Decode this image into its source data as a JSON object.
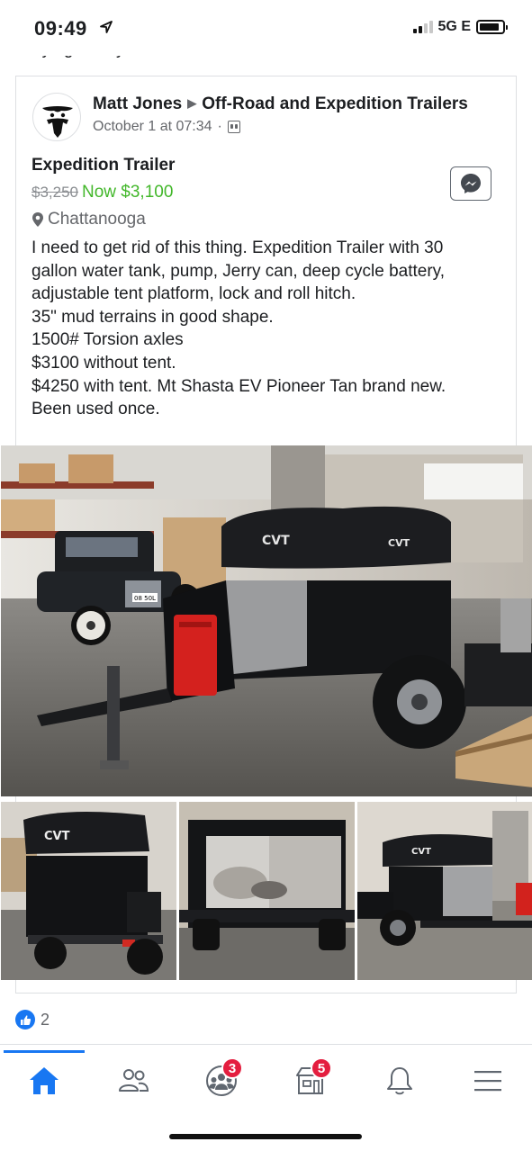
{
  "status_bar": {
    "time": "09:49",
    "network": "5G E",
    "signal_bars_on": 2,
    "signal_bars_total": 4,
    "icons": [
      "location-arrow-icon",
      "signal-icon",
      "battery-icon"
    ]
  },
  "previous_post_tail": "trying to buy a house so I need to sell it.",
  "post": {
    "author": "Matt Jones",
    "group": "Off-Road and Expedition Trailers",
    "timestamp": "October 1 at 07:34",
    "audience_icon": "group-audience-icon",
    "listing": {
      "title": "Expedition Trailer",
      "old_price": "$3,250",
      "new_price": "Now $3,100",
      "location": "Chattanooga",
      "price_color": "#42b72a"
    },
    "description": [
      "I need to get rid of this thing. Expedition Trailer with 30",
      "gallon water tank, pump, Jerry can, deep cycle battery,",
      "adjustable tent platform, lock and roll hitch.",
      "35\" mud terrains in good shape.",
      "1500# Torsion axles",
      "$3100 without tent.",
      "$4250 with tent. Mt Shasta EV  Pioneer Tan brand new.",
      "Been used once."
    ],
    "photos": {
      "main": "expedition-trailer-photo",
      "thumbnails": [
        "trailer-rear-photo",
        "trailer-open-storage-photo",
        "trailer-side-photo"
      ],
      "tent_brand_text": "CVT",
      "plate_text": "08 50L"
    },
    "reactions": {
      "like_count": "2",
      "icon": "like-icon"
    }
  },
  "bottom_nav": {
    "items": [
      {
        "name": "home",
        "icon": "home-icon",
        "badge": ""
      },
      {
        "name": "friends",
        "icon": "friends-icon",
        "badge": ""
      },
      {
        "name": "groups",
        "icon": "groups-icon",
        "badge": "3"
      },
      {
        "name": "marketplace",
        "icon": "marketplace-icon",
        "badge": "5"
      },
      {
        "name": "notifications",
        "icon": "bell-icon",
        "badge": ""
      },
      {
        "name": "menu",
        "icon": "menu-icon",
        "badge": ""
      }
    ],
    "active": "home",
    "accent_color": "#1877f2"
  }
}
